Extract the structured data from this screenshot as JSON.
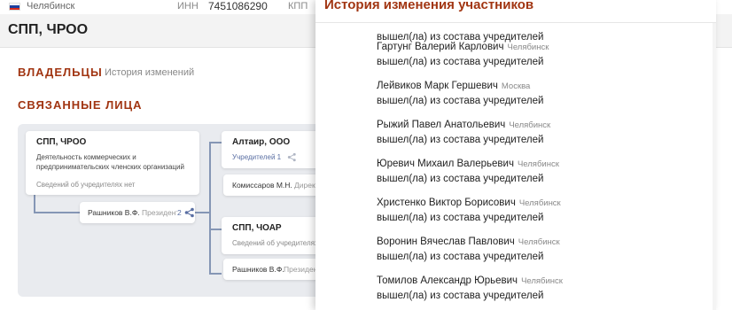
{
  "topbar": {
    "city": "Челябинск",
    "inn_label": "ИНН",
    "inn_value": "7451086290",
    "kpp_label": "КПП"
  },
  "company": {
    "name": "СПП, ЧРОО"
  },
  "owners": {
    "title": "ВЛАДЕЛЬЦЫ",
    "history_link": "История изменений"
  },
  "related": {
    "title": "СВЯЗАННЫЕ ЛИЦА",
    "main_card": {
      "title": "СПП, ЧРОО",
      "description": "Деятельность коммерческих и предпринимательских членских организаций",
      "founders_note": "Сведений об учредителях нет"
    },
    "main_person": {
      "name": "Рашников В.Ф.",
      "role": "Президент",
      "count": "2"
    },
    "card_altair": {
      "title": "Алтаир, ООО",
      "founders_label": "Учредителей 1"
    },
    "altair_person": {
      "name": "Комиссаров М.Н.",
      "role": "Директор"
    },
    "card_choar": {
      "title": "СПП, ЧОАР",
      "founders_note": "Сведений об учредителях нет"
    },
    "choar_person": {
      "name": "Рашников В.Ф.",
      "role": "Президент"
    }
  },
  "history_panel": {
    "title": "История изменения участников",
    "first_action": "вышел(ла) из состава учредителей",
    "entries": [
      {
        "name": "Гартунг Валерий Карлович",
        "city": "Челябинск",
        "action": "вышел(ла) из состава учредителей"
      },
      {
        "name": "Лейвиков Марк Гершевич",
        "city": "Москва",
        "action": "вышел(ла) из состава учредителей"
      },
      {
        "name": "Рыжий Павел Анатольевич",
        "city": "Челябинск",
        "action": "вышел(ла) из состава учредителей"
      },
      {
        "name": "Юревич Михаил Валерьевич",
        "city": "Челябинск",
        "action": "вышел(ла) из состава учредителей"
      },
      {
        "name": "Христенко Виктор Борисович",
        "city": "Челябинск",
        "action": "вышел(ла) из состава учредителей"
      },
      {
        "name": "Воронин Вячеслав Павлович",
        "city": "Челябинск",
        "action": "вышел(ла) из состава учредителей"
      },
      {
        "name": "Томилов Александр Юрьевич",
        "city": "Челябинск",
        "action": "вышел(ла) из состава учредителей"
      }
    ]
  },
  "colors": {
    "accent": "#a13512",
    "link": "#5a6fa3",
    "connector": "#8596b5",
    "diagram_bg": "#e9ebef"
  }
}
